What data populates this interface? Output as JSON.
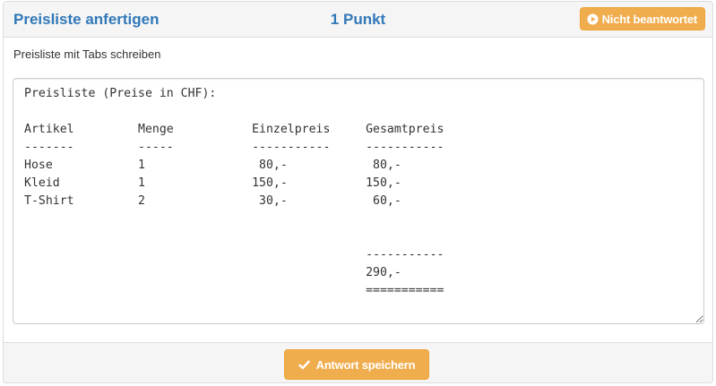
{
  "question": {
    "title": "Preisliste anfertigen",
    "points": "1 Punkt",
    "status_label": "Nicht beantwortet",
    "instructions": "Preisliste mit Tabs schreiben"
  },
  "answer": {
    "value": "Preisliste (Preise in CHF):\n\nArtikel\t\tMenge\t\tEinzelpreis\tGesamtpreis\n-------\t\t-----\t\t-----------\t-----------\nHose\t\t1\t\t 80,-\t\t 80,-\nKleid\t\t1\t\t150,-\t\t150,-\nT-Shirt\t\t2\t\t 30,-\t\t 60,-\n\n\n\t\t\t\t\t\t-----------\n\t\t\t\t\t\t290,-\n\t\t\t\t\t\t==========="
  },
  "footer": {
    "save_label": "Antwort speichern"
  },
  "colors": {
    "title": "#3178b8",
    "warning": "#f0ad4e",
    "panel_bg": "#f5f5f5"
  },
  "icons": {
    "status": "play-circle-icon",
    "save": "check-icon"
  }
}
